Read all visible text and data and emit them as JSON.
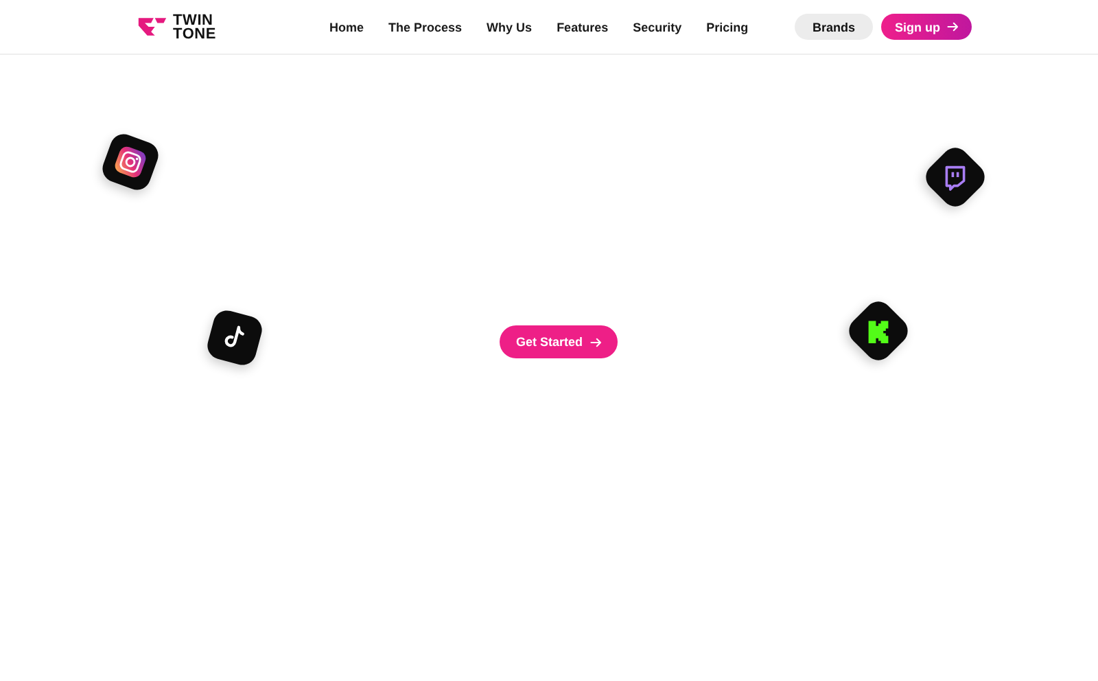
{
  "header": {
    "logo_lines": [
      "TWIN",
      "TONE"
    ],
    "nav": [
      {
        "label": "Home"
      },
      {
        "label": "The Process"
      },
      {
        "label": "Why Us"
      },
      {
        "label": "Features"
      },
      {
        "label": "Security"
      },
      {
        "label": "Pricing"
      }
    ],
    "brands_button": "Brands",
    "signup_button": "Sign up"
  },
  "hero": {
    "cta": "Get Started",
    "floating_icons": [
      {
        "kind": "instagram"
      },
      {
        "kind": "tiktok"
      },
      {
        "kind": "twitch"
      },
      {
        "kind": "kick"
      }
    ]
  }
}
